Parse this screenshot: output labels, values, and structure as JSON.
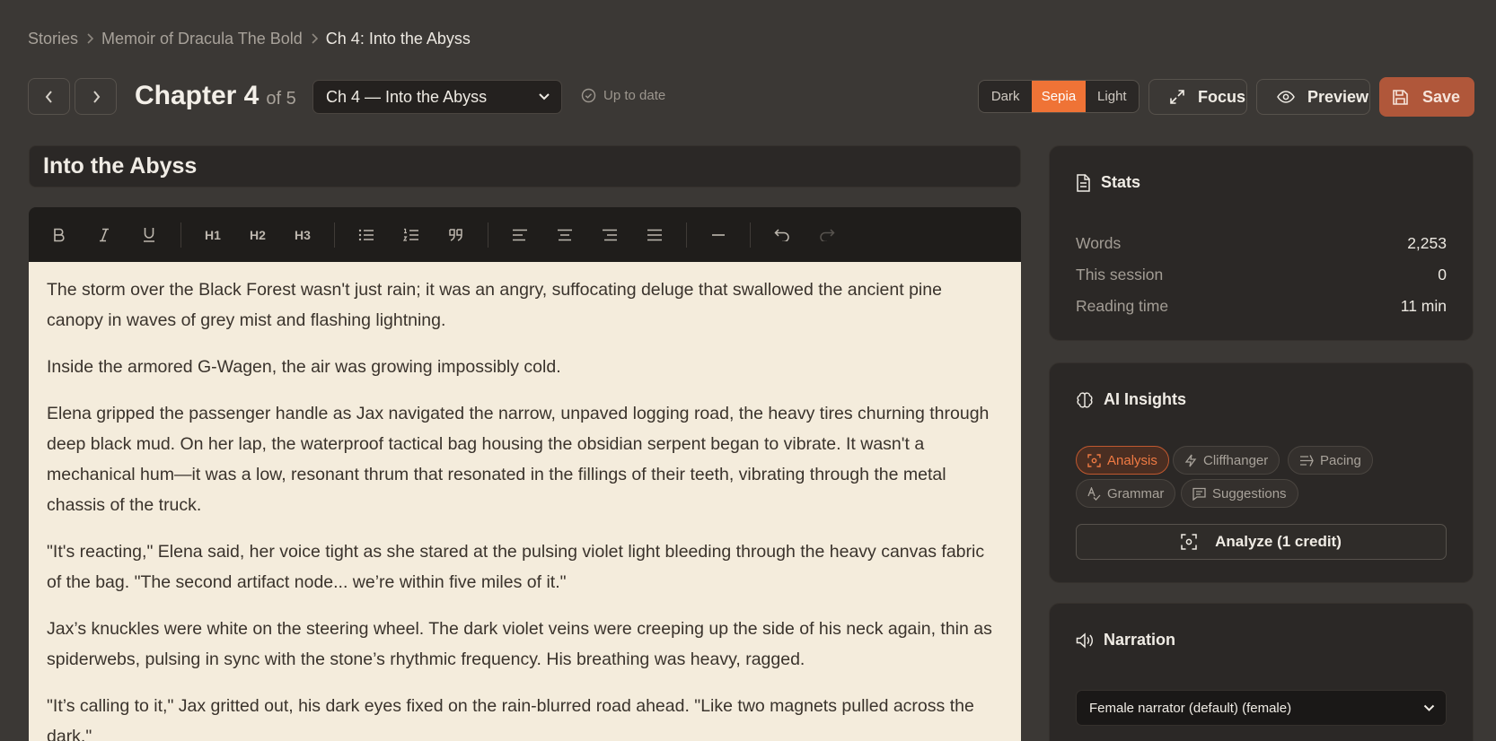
{
  "breadcrumb": {
    "items": [
      "Stories",
      "Memoir of Dracula The Bold"
    ],
    "current": "Ch 4: Into the Abyss"
  },
  "header": {
    "chapter_label": "Chapter 4",
    "chapter_of": "of 5",
    "chapter_select_value": "Ch 4 — Into the Abyss",
    "sync_status": "Up to date",
    "themes": [
      "Dark",
      "Sepia",
      "Light"
    ],
    "active_theme": "Sepia",
    "focus_label": "Focus",
    "preview_label": "Preview",
    "save_label": "Save"
  },
  "editor": {
    "title": "Into the Abyss",
    "toolbar": {
      "headings": [
        "H1",
        "H2",
        "H3"
      ]
    },
    "paragraphs": [
      "The storm over the Black Forest wasn't just rain; it was an angry, suffocating deluge that swallowed the ancient pine canopy in waves of grey mist and flashing lightning.",
      "Inside the armored G-Wagen, the air was growing impossibly cold.",
      "Elena gripped the passenger handle as Jax navigated the narrow, unpaved logging road, the heavy tires churning through deep black mud. On her lap, the waterproof tactical bag housing the obsidian serpent began to vibrate. It wasn't a mechanical hum—it was a low, resonant thrum that resonated in the fillings of their teeth, vibrating through the metal chassis of the truck.",
      "\"It's reacting,\" Elena said, her voice tight as she stared at the pulsing violet light bleeding through the heavy canvas fabric of the bag. \"The second artifact node... we’re within five miles of it.\"",
      "Jax’s knuckles were white on the steering wheel. The dark violet veins were creeping up the side of his neck again, thin as spiderwebs, pulsing in sync with the stone’s rhythmic frequency. His breathing was heavy, ragged.",
      "\"It’s calling to it,\" Jax gritted out, his dark eyes fixed on the rain-blurred road ahead. \"Like two magnets pulled across the dark.\""
    ]
  },
  "stats": {
    "title": "Stats",
    "rows": [
      {
        "label": "Words",
        "value": "2,253"
      },
      {
        "label": "This session",
        "value": "0"
      },
      {
        "label": "Reading time",
        "value": "11 min"
      }
    ]
  },
  "insights": {
    "title": "AI Insights",
    "chips": [
      "Analysis",
      "Cliffhanger",
      "Pacing",
      "Grammar",
      "Suggestions"
    ],
    "active_chip": "Analysis",
    "analyze_label": "Analyze (1 credit)"
  },
  "narration": {
    "title": "Narration",
    "voice_value": "Female narrator (default) (female)"
  },
  "colors": {
    "accent": "#ef7336",
    "save": "#b0573a",
    "editor_bg": "#f4ecdc",
    "page_bg": "#3b3835"
  }
}
